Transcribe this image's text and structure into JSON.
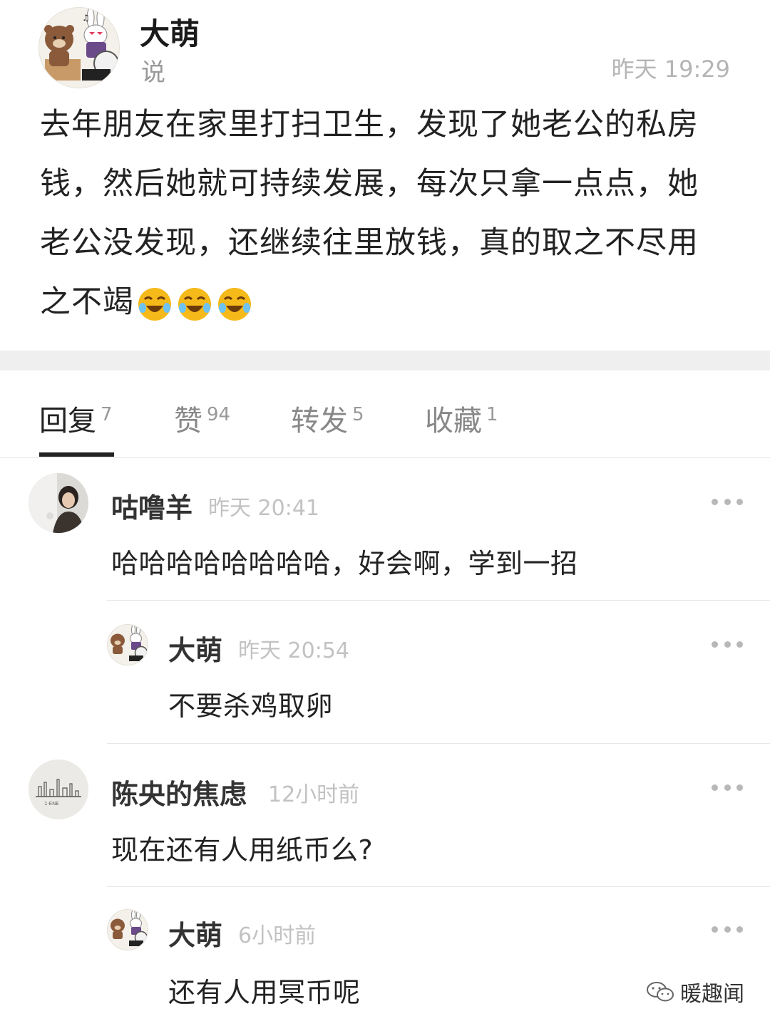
{
  "post": {
    "author": "大萌",
    "subline": "说",
    "time": "昨天 19:29",
    "text_lines": [
      "去年朋友在家里打扫卫生，发现了她老公的私房",
      "钱，然后她就可持续发展，每次只拿一点点，她",
      "老公没发现，还继续往里放钱，真的取之不尽用",
      "之不竭"
    ],
    "emoji": "laughing-crying-emoji",
    "emoji_count": 3
  },
  "tabs": [
    {
      "label": "回复",
      "count": "7",
      "active": true
    },
    {
      "label": "赞",
      "count": "94",
      "active": false
    },
    {
      "label": "转发",
      "count": "5",
      "active": false
    },
    {
      "label": "收藏",
      "count": "1",
      "active": false
    }
  ],
  "comments": [
    {
      "name": "咕噜羊",
      "time": "昨天 20:41",
      "text": "哈哈哈哈哈哈哈哈，好会啊，学到一招"
    },
    {
      "name": "大萌",
      "time": "昨天 20:54",
      "text": "不要杀鸡取卵"
    },
    {
      "name": "陈央的焦虑",
      "time": "12小时前",
      "text": "现在还有人用纸币么?"
    },
    {
      "name": "大萌",
      "time": "6小时前",
      "text": "还有人用冥币呢"
    }
  ],
  "watermark": {
    "text": "暖趣闻"
  },
  "colors": {
    "text": "#222222",
    "muted": "#999999",
    "divider": "#efefef",
    "emoji": "#f5b919"
  }
}
